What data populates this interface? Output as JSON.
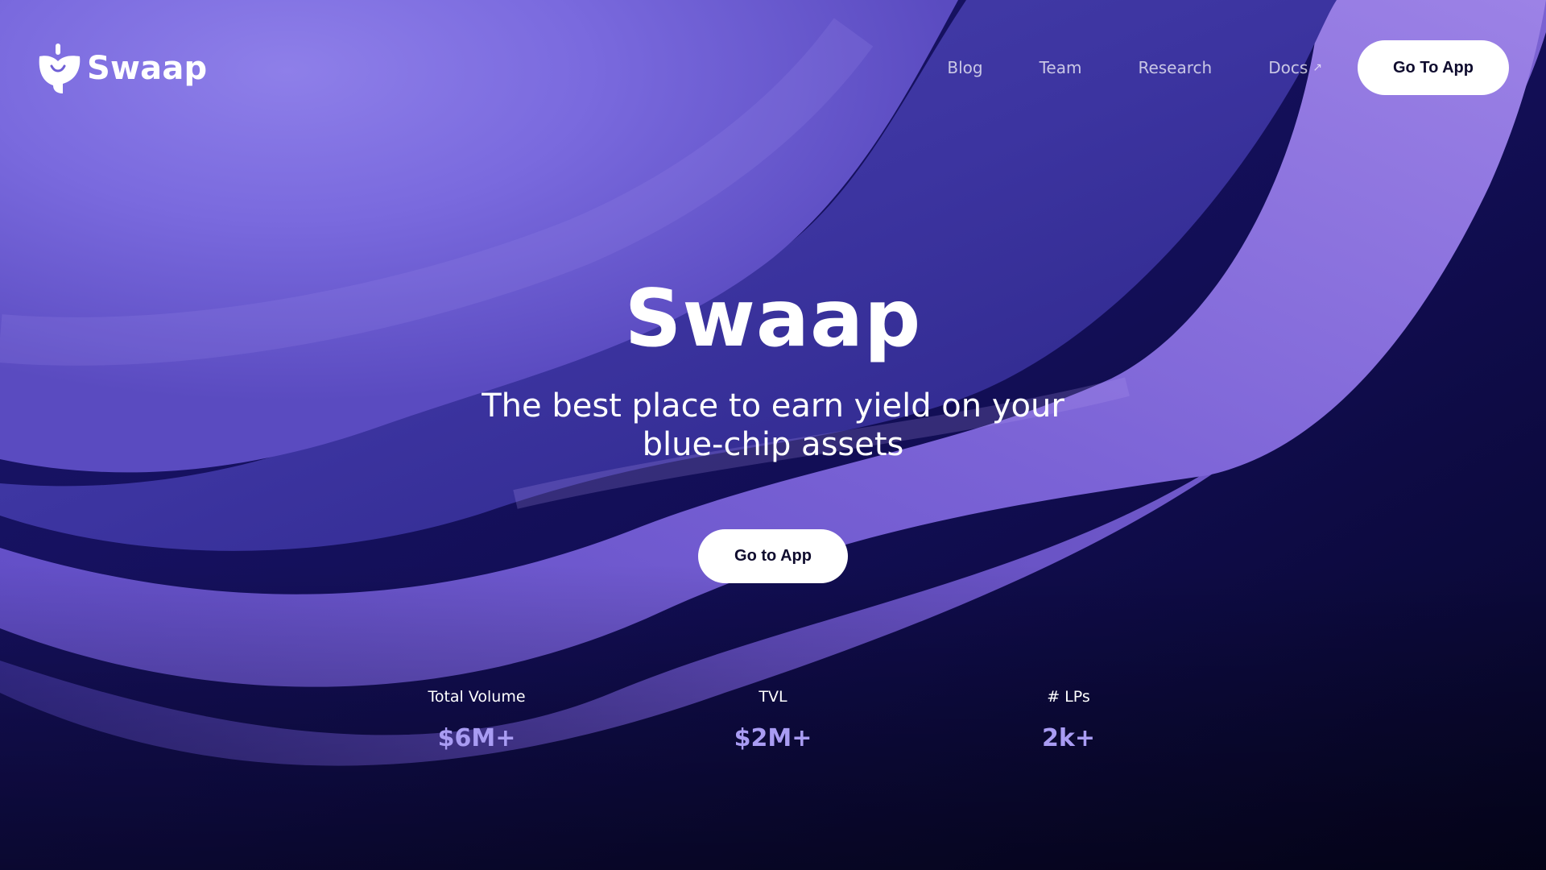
{
  "header": {
    "logo_text": "Swaap",
    "nav": [
      {
        "label": "Blog"
      },
      {
        "label": "Team"
      },
      {
        "label": "Research"
      },
      {
        "label": "Docs",
        "icon": "external-link-arrow-icon"
      }
    ],
    "cta_label": "Go To App"
  },
  "hero": {
    "title": "Swaap",
    "subtitle_line1": "The best place to earn yield on your",
    "subtitle_line2": "blue-chip assets",
    "cta_label": "Go to App"
  },
  "stats": [
    {
      "label": "Total Volume",
      "value": "$6M+"
    },
    {
      "label": "TVL",
      "value": "$2M+"
    },
    {
      "label": "# LPs",
      "value": "2k+"
    }
  ],
  "colors": {
    "accent_value": "#a99cf3",
    "wave_light": "#8a78e6",
    "wave_mid": "#5a4bc0",
    "background_dark": "#0c0a3a",
    "button_bg": "#ffffff",
    "button_text": "#0f0c2e"
  }
}
